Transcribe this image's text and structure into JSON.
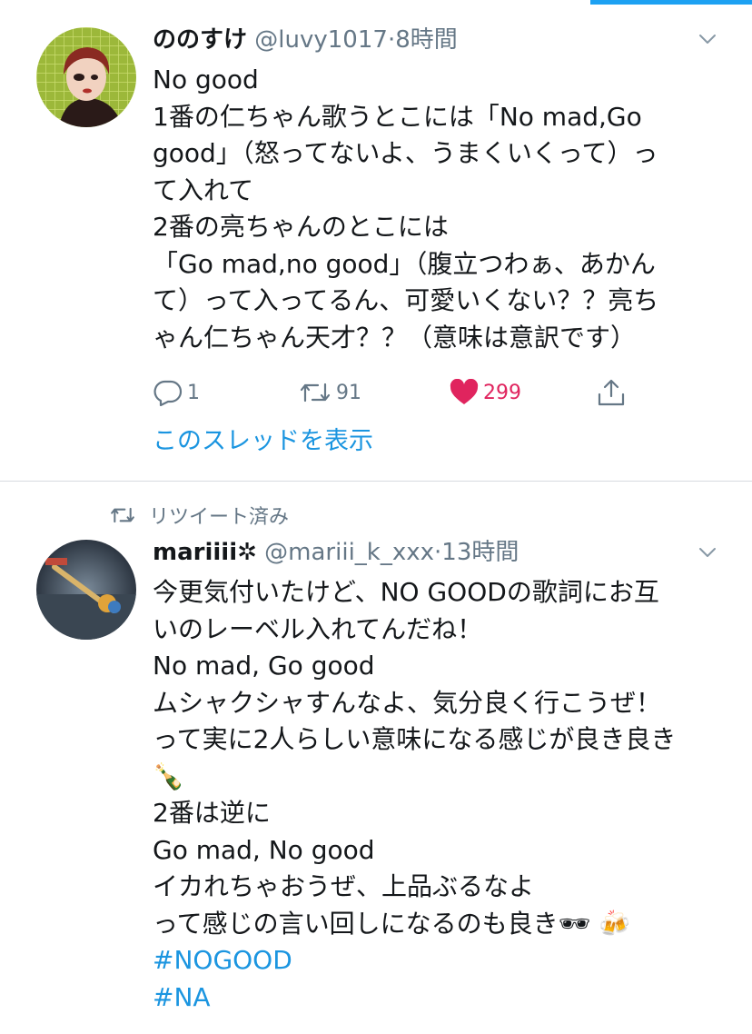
{
  "tweets": [
    {
      "display_name": "ののすけ",
      "handle": "@luvy1017",
      "separator": "·",
      "time": "8時間",
      "lines": [
        "No good",
        "1番の仁ちゃん歌うとこには「No mad,Go",
        "good」（怒ってないよ、うまくいくって）っ",
        "て入れて",
        "2番の亮ちゃんのとこには",
        "「Go mad,no good」（腹立つわぁ、あかん",
        "て）って入ってるん、可愛いくない？？亮ち",
        "ゃん仁ちゃん天才？？（意味は意訳です）"
      ],
      "reply_count": "1",
      "retweet_count": "91",
      "like_count": "299",
      "thread_link": "このスレッドを表示"
    },
    {
      "retweet_context": "リツイート済み",
      "display_name": "mariiii✲",
      "handle": "@mariii_k_xxx",
      "separator": "·",
      "time": "13時間",
      "lines": [
        "今更気付いたけど、NO GOODの歌詞にお互",
        "いのレーベル入れてんだね！",
        "No mad, Go good",
        "ムシャクシャすんなよ、気分良く行こうぜ！",
        "って実に2人らしい意味になる感じが良き良き",
        "🍾",
        "2番は逆に",
        "Go mad, No good",
        "イカれちゃおうぜ、上品ぶるなよ",
        "って感じの言い回しになるのも良き🕶 🍻"
      ],
      "hashtags": [
        "#NOGOOD",
        "#NA"
      ]
    }
  ],
  "colors": {
    "accent": "#1da1f2",
    "link": "#1b95e0",
    "like": "#e0245e",
    "secondary_text": "#657786",
    "divider": "#d6dbe0"
  },
  "icons": {
    "reply": "reply-icon",
    "retweet": "retweet-icon",
    "like": "heart-icon",
    "share": "share-icon",
    "menu": "chevron-down-icon"
  }
}
